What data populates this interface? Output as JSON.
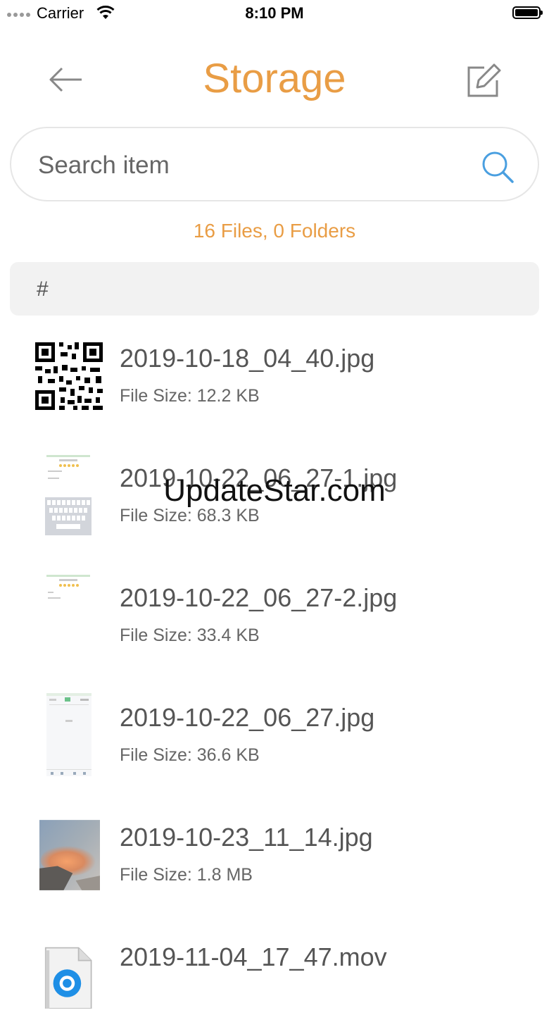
{
  "status_bar": {
    "carrier": "Carrier",
    "time": "8:10 PM"
  },
  "header": {
    "title": "Storage",
    "back_icon": "arrow-left-icon",
    "edit_icon": "edit-icon"
  },
  "search": {
    "placeholder": "Search item",
    "value": "",
    "icon": "search-icon"
  },
  "summary": "16 Files, 0 Folders",
  "section_header": "#",
  "files": [
    {
      "name": "2019-10-18_04_40.jpg",
      "size": "File Size: 12.2 KB",
      "thumb": "qr-code"
    },
    {
      "name": "2019-10-22_06_27-1.jpg",
      "size": "File Size: 68.3 KB",
      "thumb": "screenshot-keyboard"
    },
    {
      "name": "2019-10-22_06_27-2.jpg",
      "size": "File Size: 33.4 KB",
      "thumb": "screenshot-review"
    },
    {
      "name": "2019-10-22_06_27.jpg",
      "size": "File Size: 36.6 KB",
      "thumb": "screenshot-app"
    },
    {
      "name": "2019-10-23_11_14.jpg",
      "size": "File Size: 1.8 MB",
      "thumb": "photo"
    },
    {
      "name": "2019-11-04_17_47.mov",
      "size": "",
      "thumb": "quicktime-video"
    }
  ],
  "watermark": "UpdateStar.com",
  "colors": {
    "accent": "#e99d45",
    "search_icon": "#4a9fe0",
    "text": "#555555"
  }
}
